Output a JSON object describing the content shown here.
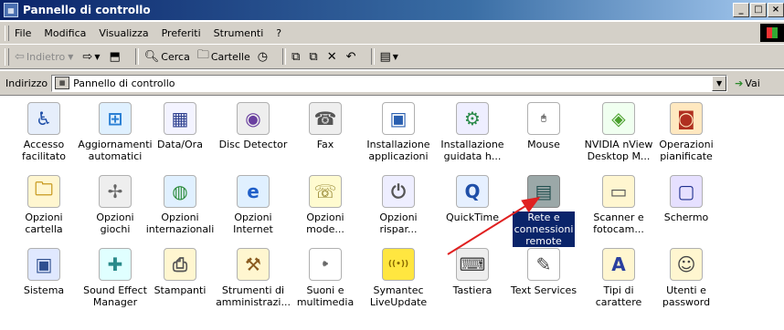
{
  "window": {
    "title": "Pannello di controllo",
    "controls": [
      "_",
      "□",
      "×"
    ]
  },
  "menu": {
    "items": [
      "File",
      "Modifica",
      "Visualizza",
      "Preferiti",
      "Strumenti",
      "?"
    ]
  },
  "toolbar": {
    "back": "Indietro",
    "search": "Cerca",
    "folders": "Cartelle"
  },
  "address": {
    "label": "Indirizzo",
    "value": "Pannello di controllo",
    "go": "Vai"
  },
  "icons": [
    {
      "label": "Accesso\nfacilitato",
      "icon": "accessibility-icon"
    },
    {
      "label": "Aggiornamenti\nautomatici",
      "icon": "windows-update-icon"
    },
    {
      "label": "Data/Ora",
      "icon": "calendar-icon"
    },
    {
      "label": "Disc Detector",
      "icon": "disc-icon"
    },
    {
      "label": "Fax",
      "icon": "fax-icon"
    },
    {
      "label": "Installazione\napplicazioni",
      "icon": "add-remove-programs-icon"
    },
    {
      "label": "Installazione\nguidata h...",
      "icon": "hardware-wizard-icon"
    },
    {
      "label": "Mouse",
      "icon": "mouse-icon"
    },
    {
      "label": "NVIDIA nView\nDesktop M...",
      "icon": "nvidia-icon"
    },
    {
      "label": "Operazioni\npianificate",
      "icon": "scheduled-tasks-icon"
    },
    {
      "label": "Opzioni\ncartella",
      "icon": "folder-options-icon"
    },
    {
      "label": "Opzioni giochi",
      "icon": "joystick-icon"
    },
    {
      "label": "Opzioni\ninternazionali",
      "icon": "globe-icon"
    },
    {
      "label": "Opzioni\nInternet",
      "icon": "internet-icon"
    },
    {
      "label": "Opzioni\nmode...",
      "icon": "modem-icon"
    },
    {
      "label": "Opzioni\nrispar...",
      "icon": "power-icon"
    },
    {
      "label": "QuickTime",
      "icon": "quicktime-icon"
    },
    {
      "label": "Rete e\nconnessioni\nremote",
      "icon": "network-icon"
    },
    {
      "label": "Scanner e\nfotocam...",
      "icon": "scanner-icon"
    },
    {
      "label": "Schermo",
      "icon": "display-icon"
    },
    {
      "label": "Sistema",
      "icon": "computer-icon"
    },
    {
      "label": "Sound Effect\nManager",
      "icon": "sound-effect-icon"
    },
    {
      "label": "Stampanti",
      "icon": "printer-icon"
    },
    {
      "label": "Strumenti di\namministrazi...",
      "icon": "admin-tools-icon"
    },
    {
      "label": "Suoni e\nmultimedia",
      "icon": "speaker-icon"
    },
    {
      "label": "Symantec\nLiveUpdate",
      "icon": "liveupdate-icon"
    },
    {
      "label": "Tastiera",
      "icon": "keyboard-icon"
    },
    {
      "label": "Text Services",
      "icon": "text-services-icon"
    },
    {
      "label": "Tipi di\ncarattere",
      "icon": "fonts-icon"
    },
    {
      "label": "Utenti e\npassword",
      "icon": "users-icon"
    }
  ],
  "selected": "Rete e\nconnessioni\nremote",
  "annotation": {
    "type": "arrow",
    "color": "#e02020"
  }
}
